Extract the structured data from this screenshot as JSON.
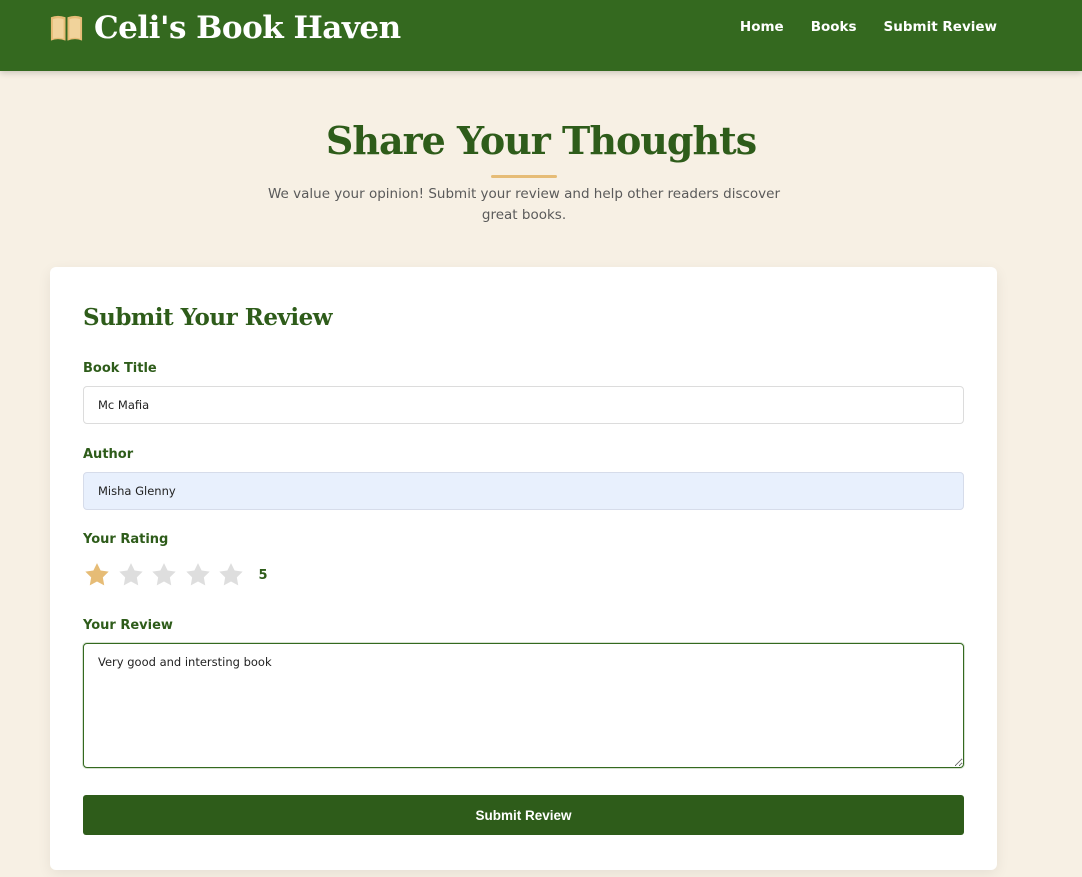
{
  "nav": {
    "brand_icon": "open-book-icon",
    "brand_name": "Celi's Book Haven",
    "links": [
      "Home",
      "Books",
      "Submit Review"
    ]
  },
  "hero": {
    "title": "Share Your Thoughts",
    "subtitle": "We value your opinion! Submit your review and help other readers discover great books."
  },
  "form": {
    "title": "Submit Your Review",
    "book_title": {
      "label": "Book Title",
      "value": "Mc Mafia"
    },
    "author": {
      "label": "Author",
      "value": "Misha Glenny"
    },
    "rating": {
      "label": "Your Rating",
      "filled_stars": 1,
      "max_stars": 5,
      "display_value": "5"
    },
    "review": {
      "label": "Your Review",
      "value": "Very good and intersting book"
    },
    "submit_label": "Submit Review"
  },
  "colors": {
    "nav_bg": "#34691f",
    "primary": "#2e5c1a",
    "accent": "#e6bc76",
    "page_bg": "#f7f0e4",
    "star_empty": "#dedede"
  }
}
